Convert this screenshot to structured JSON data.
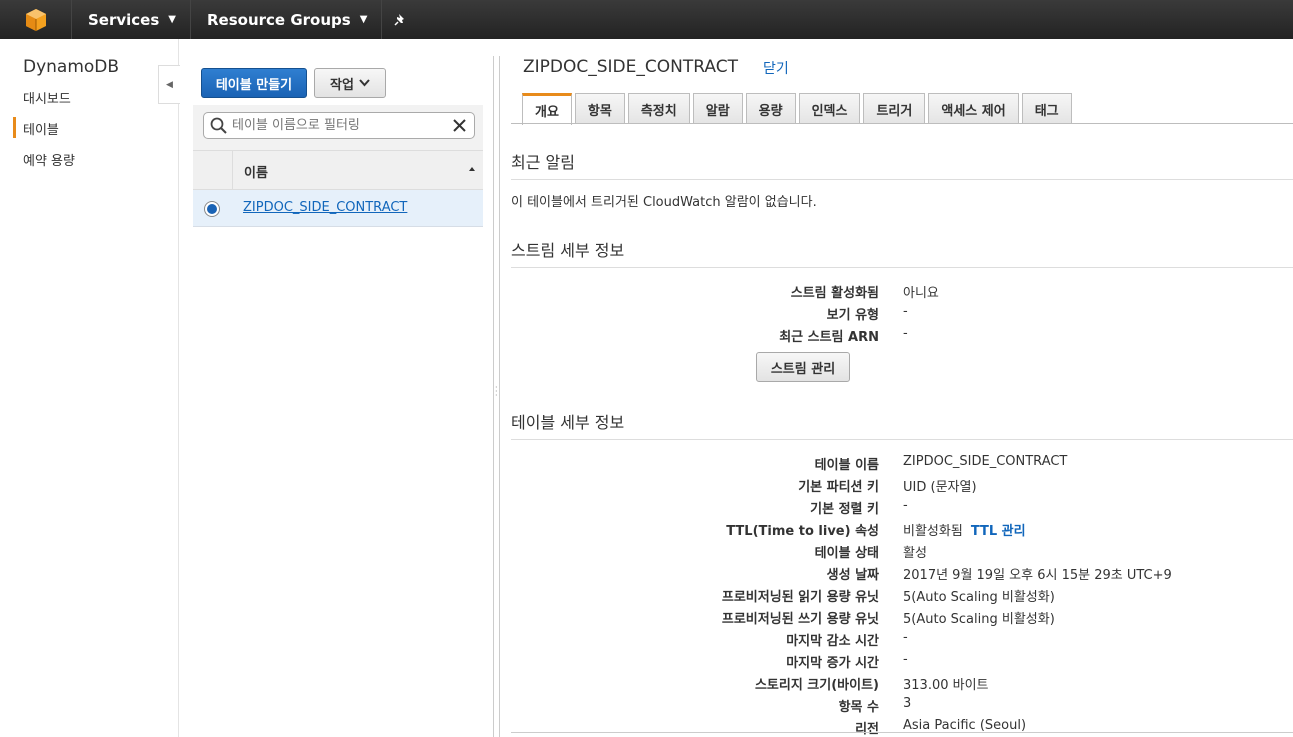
{
  "topnav": {
    "logo_icon": "aws-cube-icon",
    "services_label": "Services",
    "resource_groups_label": "Resource Groups",
    "pin_icon": "pin-icon"
  },
  "sidebar": {
    "title": "DynamoDB",
    "items": [
      {
        "label": "대시보드"
      },
      {
        "label": "테이블"
      },
      {
        "label": "예약 용량"
      }
    ],
    "active_color": "#e88b1b"
  },
  "list": {
    "create_button": "테이블 만들기",
    "actions_button": "작업",
    "filter_placeholder": "테이블 이름으로 필터링",
    "column_name": "이름",
    "rows": [
      {
        "name": "ZIPDOC_SIDE_CONTRACT",
        "selected": true
      }
    ]
  },
  "detail": {
    "title": "ZIPDOC_SIDE_CONTRACT",
    "close_label": "닫기",
    "tabs": [
      "개요",
      "항목",
      "측정치",
      "알람",
      "용량",
      "인덱스",
      "트리거",
      "액세스 제어",
      "태그"
    ],
    "active_tab": "개요",
    "alarms": {
      "heading": "최근 알림",
      "text": "이 테이블에서 트리거된 CloudWatch 알람이 없습니다."
    },
    "stream": {
      "heading": "스트림 세부 정보",
      "rows": [
        {
          "label": "스트림 활성화됨",
          "value": "아니요"
        },
        {
          "label": "보기 유형",
          "value": "-"
        },
        {
          "label": "최근 스트림 ARN",
          "value": "-"
        }
      ],
      "manage_button": "스트림 관리"
    },
    "table_details": {
      "heading": "테이블 세부 정보",
      "rows": [
        {
          "label": "테이블 이름",
          "value": "ZIPDOC_SIDE_CONTRACT"
        },
        {
          "label": "기본 파티션 키",
          "value": "UID (문자열)"
        },
        {
          "label": "기본 정렬 키",
          "value": "-"
        },
        {
          "label": "TTL(Time to live) 속성",
          "value": "비활성화됨",
          "link": "TTL 관리"
        },
        {
          "label": "테이블 상태",
          "value": "활성"
        },
        {
          "label": "생성 날짜",
          "value": "2017년 9월 19일 오후 6시 15분 29초 UTC+9"
        },
        {
          "label": "프로비저닝된 읽기 용량 유닛",
          "value": "5(Auto Scaling 비활성화)"
        },
        {
          "label": "프로비저닝된 쓰기 용량 유닛",
          "value": "5(Auto Scaling 비활성화)"
        },
        {
          "label": "마지막 감소 시간",
          "value": "-"
        },
        {
          "label": "마지막 증가 시간",
          "value": "-"
        },
        {
          "label": "스토리지 크기(바이트)",
          "value": "313.00 바이트"
        },
        {
          "label": "항목 수",
          "value": "3"
        },
        {
          "label": "리전",
          "value": "Asia Pacific (Seoul)"
        }
      ]
    }
  }
}
